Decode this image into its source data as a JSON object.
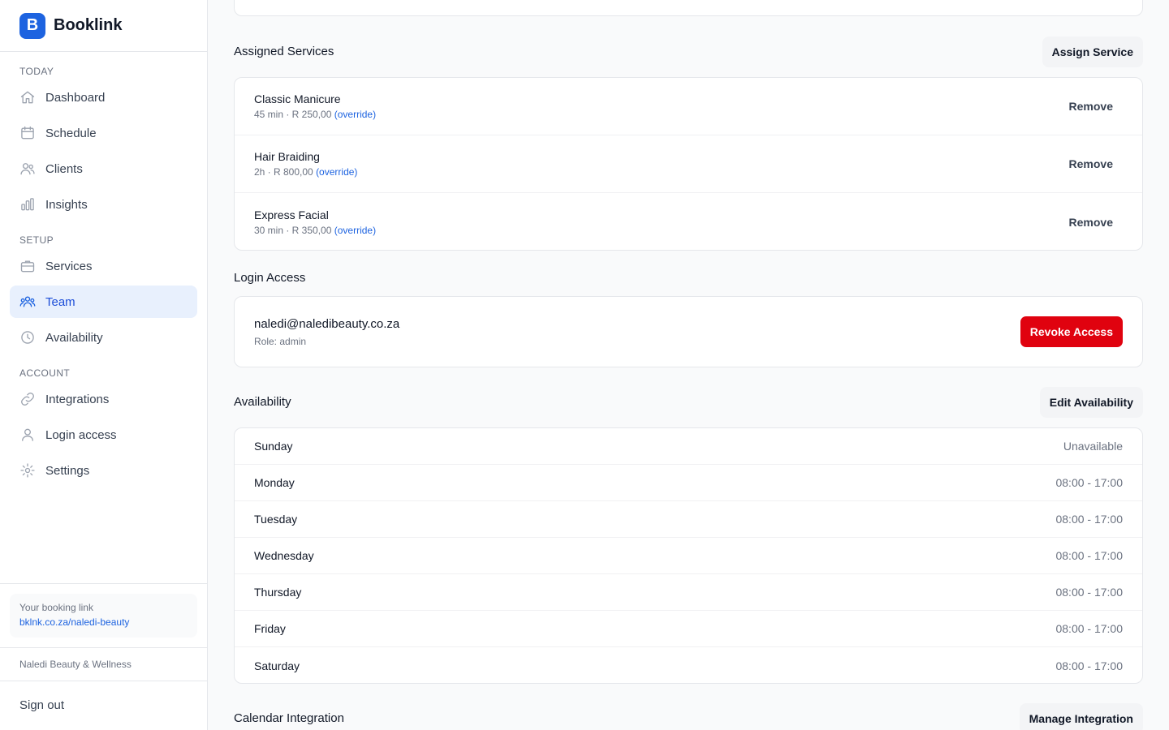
{
  "app": {
    "name": "Booklink",
    "logo_letter": "B"
  },
  "sidebar": {
    "sections": [
      {
        "label": "Today"
      },
      {
        "label": "Setup"
      },
      {
        "label": "Account"
      }
    ],
    "items": [
      {
        "label": "Dashboard",
        "icon": "home-icon"
      },
      {
        "label": "Schedule",
        "icon": "calendar-icon"
      },
      {
        "label": "Clients",
        "icon": "users-icon"
      },
      {
        "label": "Insights",
        "icon": "bar-chart-icon"
      },
      {
        "label": "Services",
        "icon": "briefcase-icon"
      },
      {
        "label": "Team",
        "icon": "team-icon",
        "active": true
      },
      {
        "label": "Availability",
        "icon": "clock-icon"
      },
      {
        "label": "Integrations",
        "icon": "link-icon"
      },
      {
        "label": "Login access",
        "icon": "user-icon"
      },
      {
        "label": "Settings",
        "icon": "gear-icon"
      }
    ],
    "booking_link": {
      "title": "Your booking link",
      "url": "bklnk.co.za/naledi-beauty"
    },
    "business_name": "Naledi Beauty & Wellness",
    "sign_out": "Sign out"
  },
  "assigned_services": {
    "title": "Assigned Services",
    "button": "Assign Service",
    "remove_label": "Remove",
    "items": [
      {
        "name": "Classic Manicure",
        "meta": "45 min · R 250,00",
        "override": "(override)"
      },
      {
        "name": "Hair Braiding",
        "meta": "2h · R 800,00",
        "override": "(override)"
      },
      {
        "name": "Express Facial",
        "meta": "30 min · R 350,00",
        "override": "(override)"
      }
    ]
  },
  "login_access": {
    "title": "Login Access",
    "email": "naledi@naledibeauty.co.za",
    "role": "Role: admin",
    "button": "Revoke Access"
  },
  "availability": {
    "title": "Availability",
    "button": "Edit Availability",
    "days": [
      {
        "day": "Sunday",
        "hours": "Unavailable"
      },
      {
        "day": "Monday",
        "hours": "08:00 - 17:00"
      },
      {
        "day": "Tuesday",
        "hours": "08:00 - 17:00"
      },
      {
        "day": "Wednesday",
        "hours": "08:00 - 17:00"
      },
      {
        "day": "Thursday",
        "hours": "08:00 - 17:00"
      },
      {
        "day": "Friday",
        "hours": "08:00 - 17:00"
      },
      {
        "day": "Saturday",
        "hours": "08:00 - 17:00"
      }
    ]
  },
  "calendar_integration": {
    "title": "Calendar Integration",
    "button": "Manage Integration"
  },
  "colors": {
    "accent": "#1d63e0",
    "danger": "#e0020f",
    "active_bg": "#e8f0fd"
  }
}
